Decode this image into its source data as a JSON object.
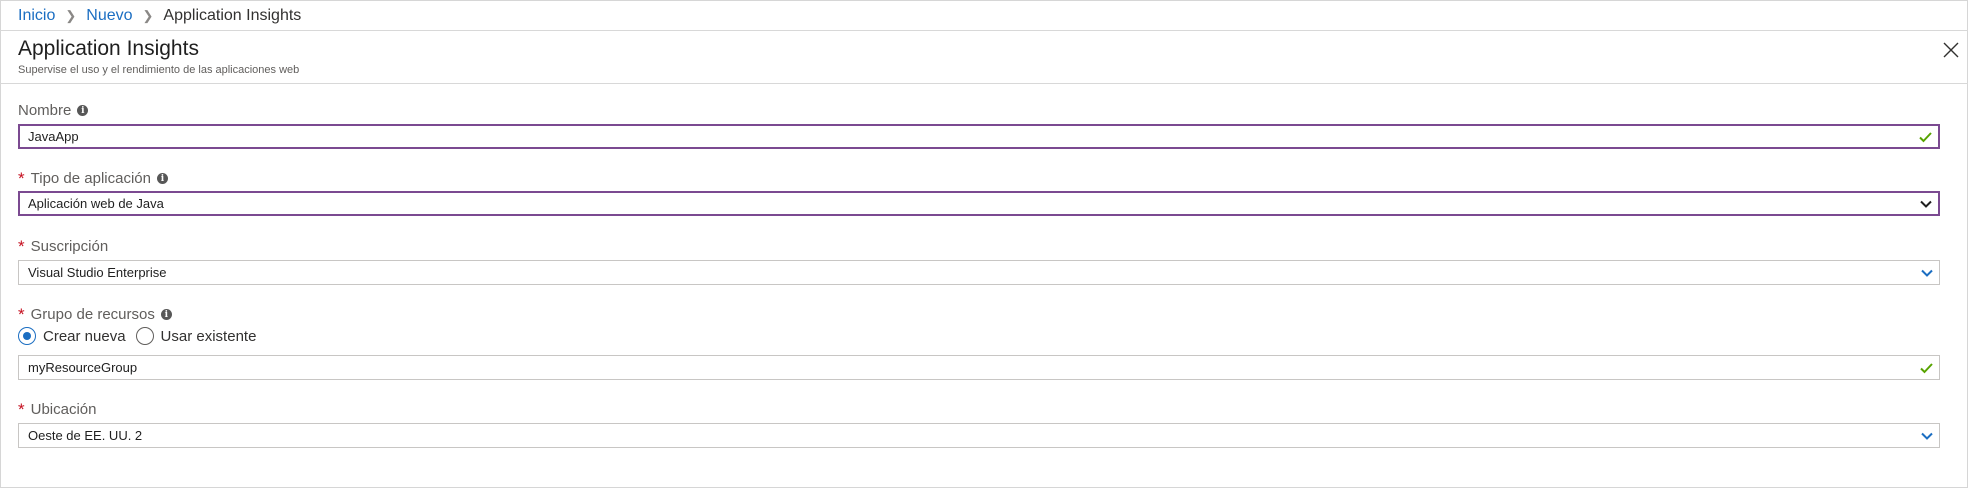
{
  "breadcrumb": {
    "items": [
      "Inicio",
      "Nuevo"
    ],
    "current": "Application Insights"
  },
  "blade": {
    "title": "Application Insights",
    "subtitle": "Supervise el uso y el rendimiento de las aplicaciones web",
    "close_icon": "close-icon"
  },
  "form": {
    "name": {
      "label": "Nombre",
      "value": "JavaApp",
      "valid_icon": "checkmark-icon"
    },
    "app_type": {
      "label": "Tipo de aplicación",
      "required": "*",
      "value": "Aplicación web de Java"
    },
    "subscription": {
      "label": "Suscripción",
      "required": "*",
      "value": "Visual Studio Enterprise"
    },
    "resource_group": {
      "label": "Grupo de recursos",
      "required": "*",
      "options": [
        "Crear nueva",
        "Usar existente"
      ],
      "selected": "Crear nueva",
      "value": "myResourceGroup"
    },
    "location": {
      "label": "Ubicación",
      "required": "*",
      "value": "Oeste de EE. UU. 2"
    }
  },
  "colors": {
    "link": "#1b6ec2",
    "focus_border": "#7b4a91",
    "valid_check": "#57a300",
    "required": "#c50f1f"
  }
}
